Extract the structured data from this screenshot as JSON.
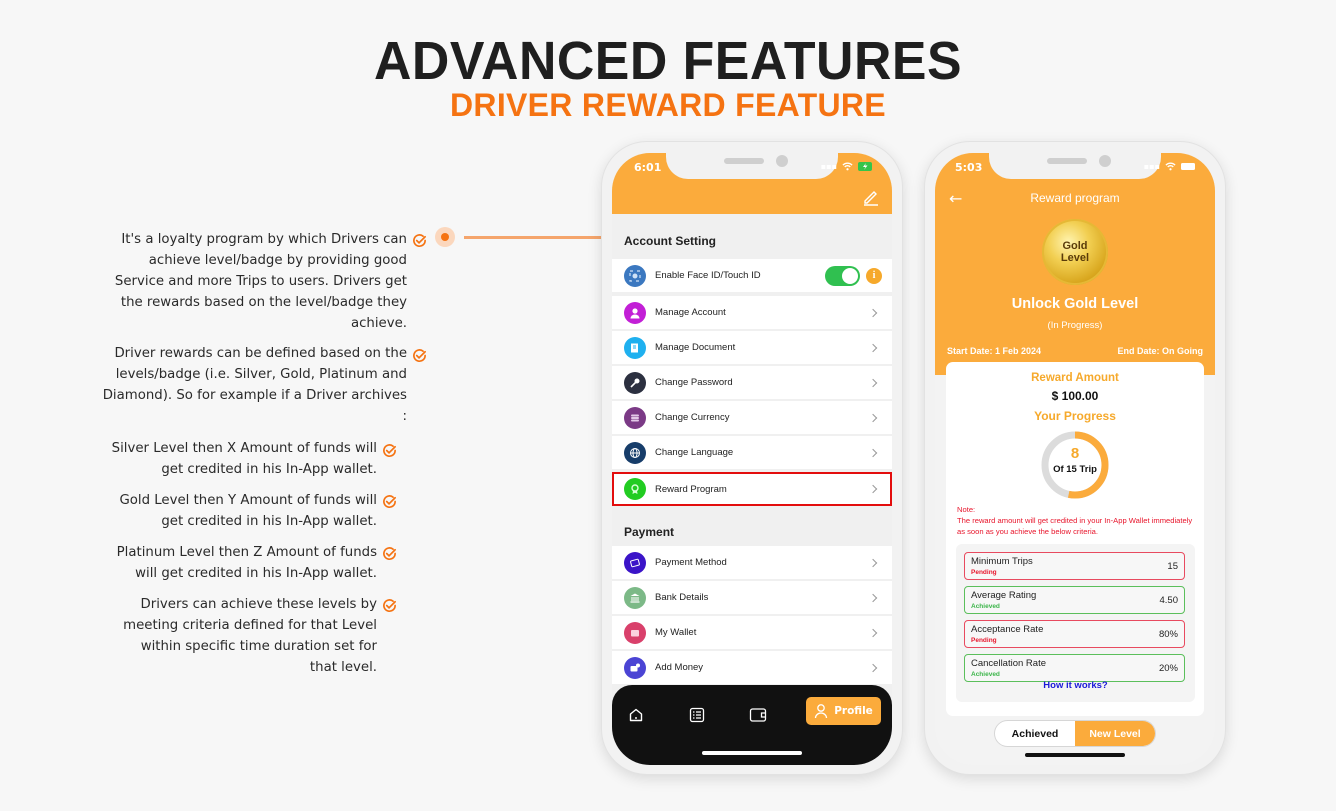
{
  "header": {
    "title": "ADVANCED FEATURES",
    "subtitle": "DRIVER REWARD FEATURE"
  },
  "features": [
    {
      "text": "It's a loyalty program by which Drivers can achieve level/badge by providing good Service and more Trips to users. Drivers get the rewards based on the level/badge they achieve.",
      "icon": "check-circle-icon"
    },
    {
      "text": "Driver rewards can be defined based on the levels/badge (i.e. Silver, Gold, Platinum and Diamond). So for example if a Driver archives :",
      "icon": "check-circle-icon"
    },
    {
      "text": "Silver Level then X Amount of funds will get credited in his In-App wallet.",
      "icon": "check-circle-icon"
    },
    {
      "text": "Gold Level then Y Amount of funds will get credited in his In-App wallet.",
      "icon": "check-circle-icon"
    },
    {
      "text": "Platinum Level then Z Amount of funds will get credited in his In-App wallet.",
      "icon": "check-circle-icon"
    },
    {
      "text": "Drivers can achieve these levels by meeting criteria defined for that Level within specific time duration set for that level.",
      "icon": "check-circle-icon"
    }
  ],
  "colors": {
    "accent": "#f57312",
    "app_orange": "#fbab3c",
    "highlight": "#e30d0d",
    "achieved": "#3cb54a",
    "pending": "#e8162c"
  },
  "phone1": {
    "status_time": "6:01",
    "sections": {
      "account": "Account Setting",
      "payment": "Payment"
    },
    "account_items": [
      {
        "label": "Enable Face ID/Touch ID",
        "icon": "face-id-icon",
        "toggle": true
      },
      {
        "label": "Manage Account",
        "icon": "user-icon"
      },
      {
        "label": "Manage Document",
        "icon": "document-icon"
      },
      {
        "label": "Change Password",
        "icon": "key-icon"
      },
      {
        "label": "Change Currency",
        "icon": "currency-icon"
      },
      {
        "label": "Change Language",
        "icon": "globe-icon"
      },
      {
        "label": "Reward Program",
        "icon": "award-icon",
        "highlighted": true
      }
    ],
    "payment_items": [
      {
        "label": "Payment Method",
        "icon": "card-icon"
      },
      {
        "label": "Bank Details",
        "icon": "bank-icon"
      },
      {
        "label": "My Wallet",
        "icon": "wallet-icon"
      },
      {
        "label": "Add Money",
        "icon": "add-money-icon"
      }
    ],
    "nav": {
      "active_label": "Profile",
      "items": [
        "home-icon",
        "checklist-icon",
        "wallet-icon",
        "profile-icon"
      ]
    }
  },
  "phone2": {
    "status_time": "5:03",
    "title": "Reward program",
    "medal": {
      "line1": "Gold",
      "line2": "Level"
    },
    "unlock_title": "Unlock Gold Level",
    "status": "(In Progress)",
    "start_date": "Start Date: 1 Feb 2024",
    "end_date": "End Date: On Going",
    "reward_label": "Reward Amount",
    "reward_amount": "$ 100.00",
    "progress_label": "Your Progress",
    "progress": {
      "current": "8",
      "total_text": "Of 15 Trip",
      "fraction": 0.533
    },
    "note_title": "Note:",
    "note_text": "The reward amount will get credited in your In-App Wallet immediately as soon as you achieve the below criteria.",
    "criteria": [
      {
        "name": "Minimum Trips",
        "status": "Pending",
        "value": "15"
      },
      {
        "name": "Average Rating",
        "status": "Achieved",
        "value": "4.50"
      },
      {
        "name": "Acceptance Rate",
        "status": "Pending",
        "value": "80%"
      },
      {
        "name": "Cancellation Rate",
        "status": "Achieved",
        "value": "20%"
      }
    ],
    "how_it_works": "How it works?",
    "tabs": {
      "achieved": "Achieved",
      "new_level": "New Level"
    }
  }
}
